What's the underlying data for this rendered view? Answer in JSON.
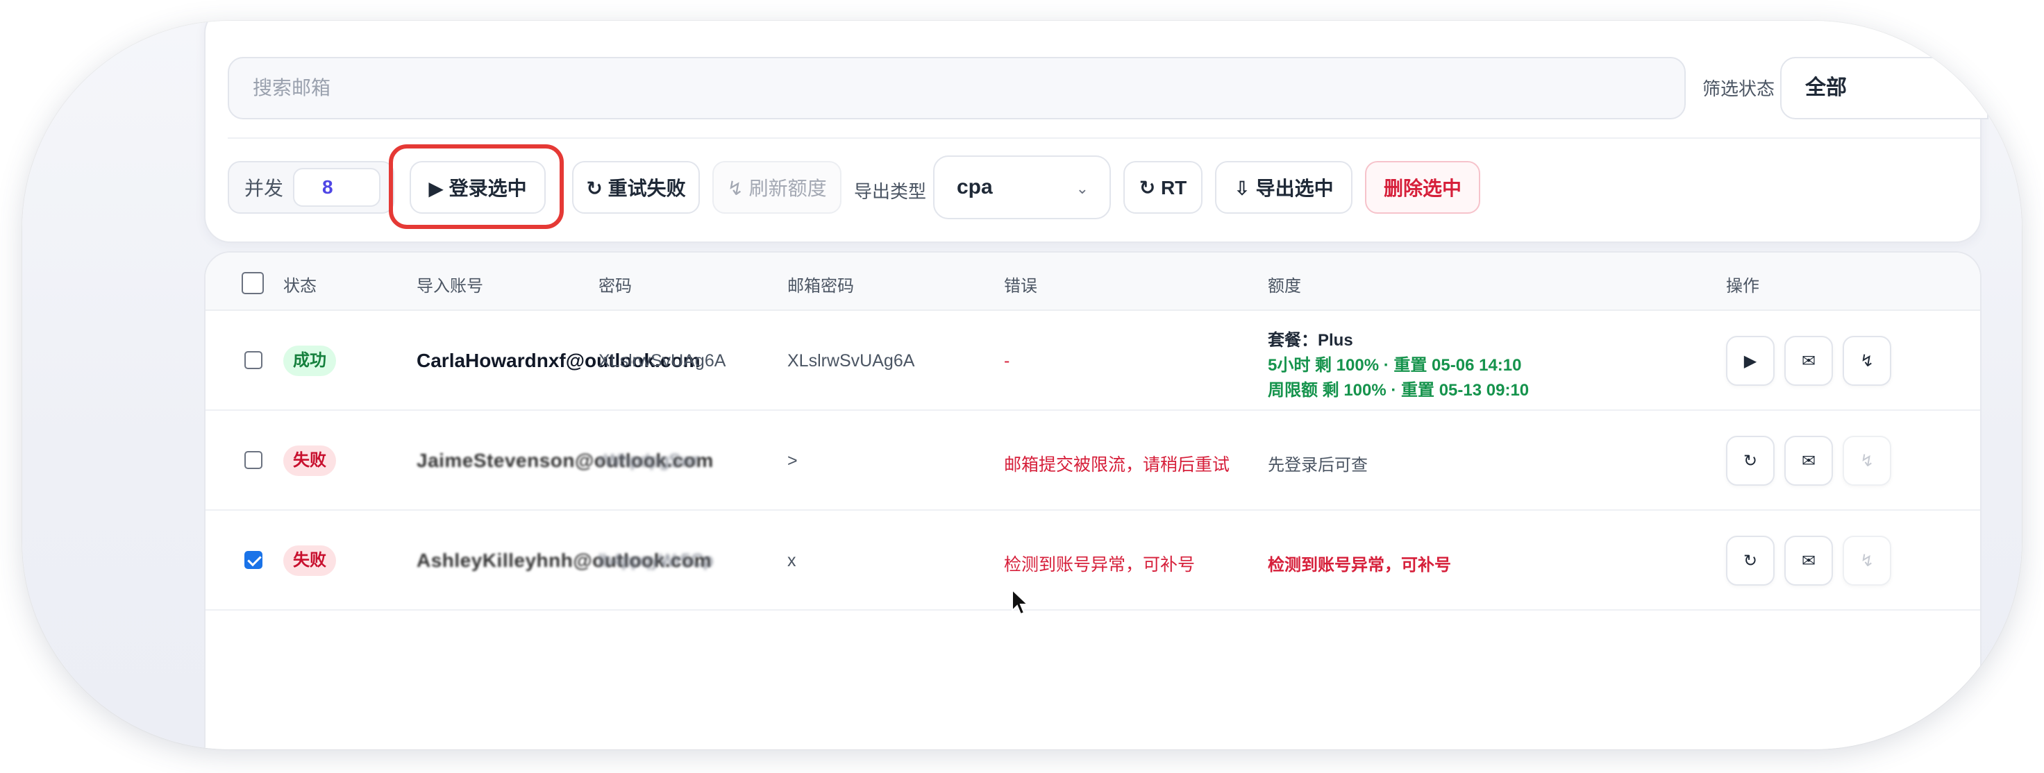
{
  "filters": {
    "search_placeholder": "搜索邮箱",
    "status_label": "筛选状态",
    "status_value": "全部"
  },
  "toolbar": {
    "concurrency_label": "并发",
    "concurrency_value": "8",
    "login_selected": "▶ 登录选中",
    "retry_failed": "↻ 重试失败",
    "refresh_quota": "↯ 刷新额度",
    "export_type_label": "导出类型",
    "export_type_value": "cpa",
    "export_type_chevron": "⌄",
    "rt_label": "↻ RT",
    "export_selected": "⇩ 导出选中",
    "delete_selected": "删除选中"
  },
  "table": {
    "headers": {
      "status": "状态",
      "account": "导入账号",
      "password": "密码",
      "mail_password": "邮箱密码",
      "error": "错误",
      "quota": "额度",
      "actions": "操作"
    },
    "rows": [
      {
        "checked": false,
        "status": "成功",
        "account": "CarlaHowardnxf@outlook.com",
        "password": "XLslrwSvUAg6A",
        "mail_password": "XLslrwSvUAg6A",
        "error": "-",
        "quota_plan": "套餐：Plus",
        "quota_line1": "5小时 剩 100% · 重置 05-06 14:10",
        "quota_line2": "周限额 剩 100% · 重置 05-13 09:10",
        "act1": "▶",
        "act2": "✉",
        "act3": "↯"
      },
      {
        "checked": false,
        "status": "失败",
        "account": "JaimeStevenson@outlook.com",
        "password": "rWhpdpgSwr",
        "mail_password": ">",
        "error": "邮箱提交被限流，请稍后重试",
        "quota_text": "先登录后可查",
        "act1": "↻",
        "act2": "✉",
        "act3": "↯"
      },
      {
        "checked": true,
        "status": "失败",
        "account": "AshleyKilleyhnh@outlook.com",
        "password": "lb4ppqyWr5Cp",
        "mail_password": "x",
        "error": "检测到账号异常，可补号",
        "quota_text": "检测到账号异常，可补号",
        "act1": "↻",
        "act2": "✉",
        "act3": "↯"
      }
    ]
  }
}
